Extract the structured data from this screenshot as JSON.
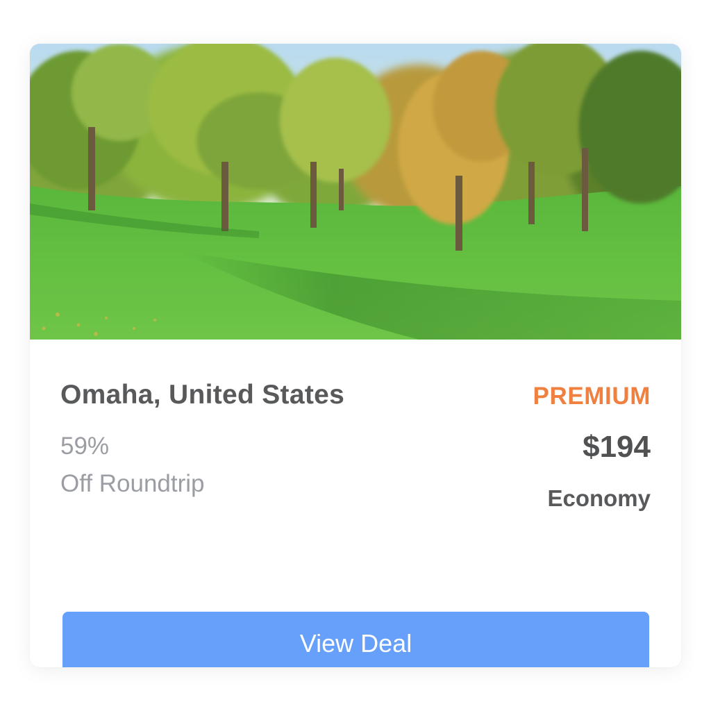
{
  "deal": {
    "destination": "Omaha, United States",
    "discount": "59%",
    "trip_type": "Off Roundtrip",
    "tier": "PREMIUM",
    "price": "$194",
    "cabin": "Economy",
    "cta_label": "View Deal",
    "image_subject": "park-trees-lawn"
  },
  "colors": {
    "tier": "#f08040",
    "cta_background": "#66a0fa",
    "title_text": "#58595b",
    "muted_text": "#9a9da3"
  }
}
